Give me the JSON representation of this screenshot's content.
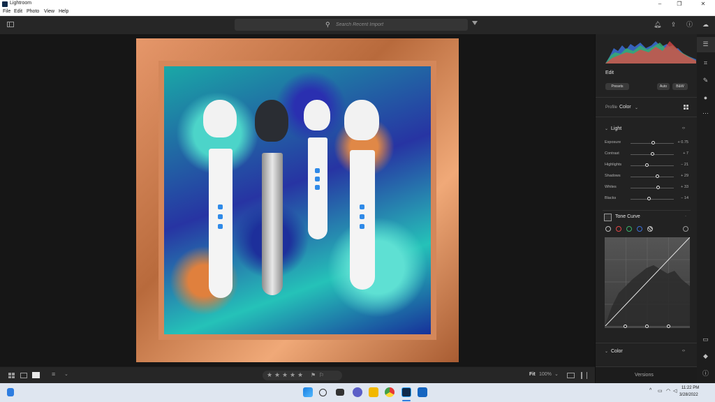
{
  "window": {
    "title": "Lightroom"
  },
  "menu": [
    "File",
    "Edit",
    "Photo",
    "View",
    "Help"
  ],
  "toolbar": {
    "search_placeholder": "Search Recent Import"
  },
  "bottombar": {
    "stars": [
      "★",
      "★",
      "★",
      "★",
      "★"
    ],
    "fit_label": "Fit",
    "zoom_label": "100%"
  },
  "edit": {
    "heading": "Edit",
    "presets_label": "Presets",
    "auto_label": "Auto",
    "bw_label": "B&W",
    "profile_label": "Profile",
    "profile_value": "Color",
    "light_heading": "Light",
    "sliders": [
      {
        "label": "Exposure",
        "value": "+ 0.75",
        "position": 0.54
      },
      {
        "label": "Contrast",
        "value": "+ 7",
        "position": 0.51
      },
      {
        "label": "Highlights",
        "value": "− 21",
        "position": 0.38
      },
      {
        "label": "Shadows",
        "value": "+ 29",
        "position": 0.63
      },
      {
        "label": "Whites",
        "value": "+ 33",
        "position": 0.65
      },
      {
        "label": "Blacks",
        "value": "− 14",
        "position": 0.43
      }
    ],
    "tone_curve_heading": "Tone Curve",
    "color_heading": "Color",
    "versions_label": "Versions"
  },
  "taskbar": {
    "time": "11:22 PM",
    "date": "3/28/2022"
  },
  "colors": {
    "accent_blue": "#2f8ae8",
    "panel_bg": "#222222",
    "canvas_bg": "#161616"
  },
  "icons": {
    "panel_toggle": "sidebar-icon",
    "search": "search-icon",
    "filter": "filter-icon",
    "notifications": "bell-icon",
    "share": "share-icon",
    "help": "help-icon",
    "cloud": "cloud-icon",
    "edit": "sliders-icon",
    "crop": "crop-icon",
    "heal": "bandage-icon",
    "mask": "circle-icon",
    "more": "more-icon",
    "comment": "comment-icon",
    "tag": "tag-icon",
    "info": "info-icon"
  }
}
